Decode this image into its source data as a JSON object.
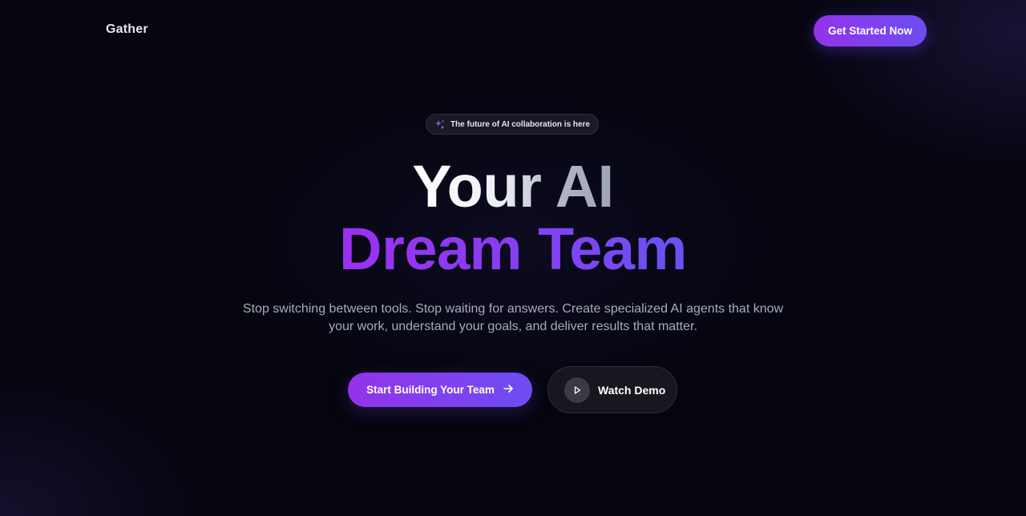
{
  "nav": {
    "logo": "Gather",
    "cta_label": "Get Started Now"
  },
  "hero": {
    "badge_text": "The future of AI collaboration is here",
    "badge_icon": "sparkle-icon",
    "headline_line1": "Your AI",
    "headline_line2": "Dream Team",
    "subtitle_line1": "Stop switching between tools. Stop waiting for answers. Create specialized AI agents that know",
    "subtitle_line2": "your work, understand your goals, and deliver results that matter.",
    "primary_button_label": "Start Building Your Team",
    "primary_button_icon": "arrow-right-icon",
    "secondary_button_label": "Watch Demo",
    "secondary_button_icon": "play-icon"
  },
  "colors": {
    "background": "#05050f",
    "accent_start": "#9333ea",
    "accent_end": "#6d4df2",
    "text_primary": "#ffffff",
    "text_muted": "#a8abbd"
  }
}
